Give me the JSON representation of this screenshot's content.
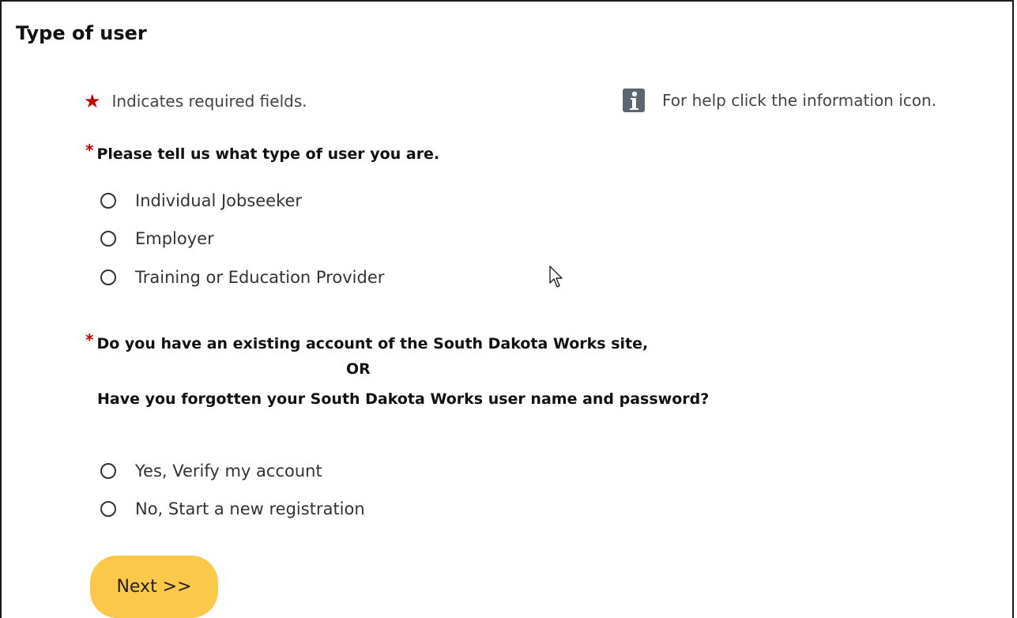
{
  "title": "Type of user",
  "required_note": {
    "star": "★",
    "text": "Indicates required fields."
  },
  "help_note": {
    "icon": "info-icon",
    "text": "For help click the information icon."
  },
  "question1": {
    "star": "*",
    "label": "Please tell us what type of user you are.",
    "options": [
      "Individual Jobseeker",
      "Employer",
      "Training or Education Provider"
    ]
  },
  "question2": {
    "star": "*",
    "line1": "Do you have an existing account of the South Dakota Works site,",
    "or": "OR",
    "line2": "Have you forgotten your South Dakota Works user name and password?",
    "options": [
      "Yes, Verify my account",
      "No, Start a new registration"
    ]
  },
  "next_button": "Next >>",
  "colors": {
    "accent_button": "#fbc84a",
    "required_star": "#c00000",
    "info_icon": "#5b6670"
  }
}
